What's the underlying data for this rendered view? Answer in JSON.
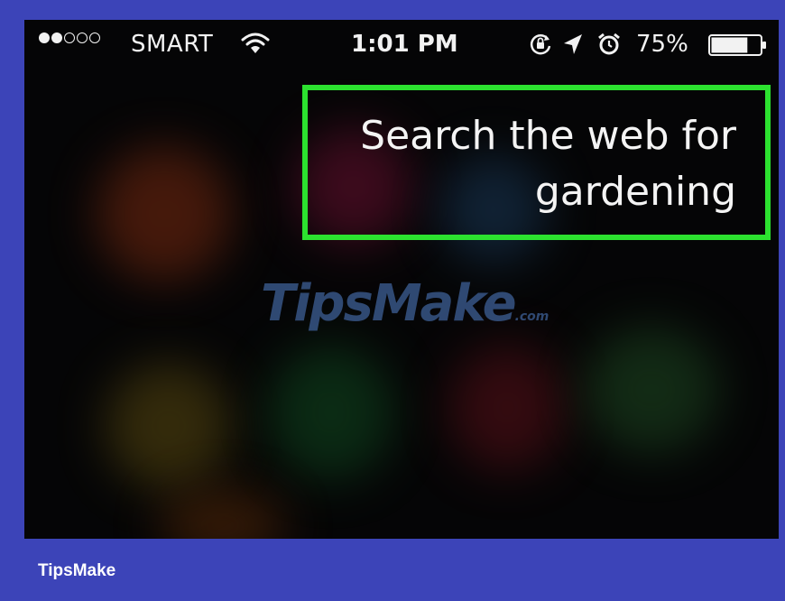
{
  "status_bar": {
    "signal_filled": 2,
    "signal_empty": 3,
    "carrier": "SMART",
    "time": "1:01 PM",
    "battery_percent": "75%",
    "battery_level": 0.75,
    "icons": [
      "wifi-icon",
      "rotation-lock-icon",
      "location-icon",
      "alarm-icon",
      "battery-icon"
    ]
  },
  "siri": {
    "query": "Search the web for\ngardening",
    "highlight_color": "#2ce22f"
  },
  "watermark": {
    "main": "TipsMake",
    "suffix": ".com"
  },
  "footer": {
    "brand": "TipsMake",
    "background": "#3c44b8"
  }
}
